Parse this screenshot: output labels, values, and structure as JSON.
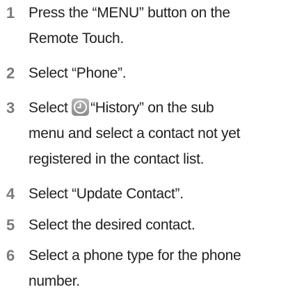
{
  "steps": [
    {
      "number": "1",
      "lines": [
        "Press the “MENU” button on the",
        "Remote Touch."
      ]
    },
    {
      "number": "2",
      "lines": [
        "Select “Phone”."
      ]
    },
    {
      "number": "3",
      "pre": "Select ",
      "icon": "history-clock-icon",
      "post": "“History” on the sub",
      "lines": [
        "menu and select a contact not yet",
        "registered in the contact list."
      ]
    },
    {
      "number": "4",
      "lines": [
        "Select “Update Contact”."
      ]
    },
    {
      "number": "5",
      "lines": [
        "Select the desired contact."
      ]
    },
    {
      "number": "6",
      "lines": [
        "Select a phone type for the phone",
        "number."
      ]
    }
  ]
}
